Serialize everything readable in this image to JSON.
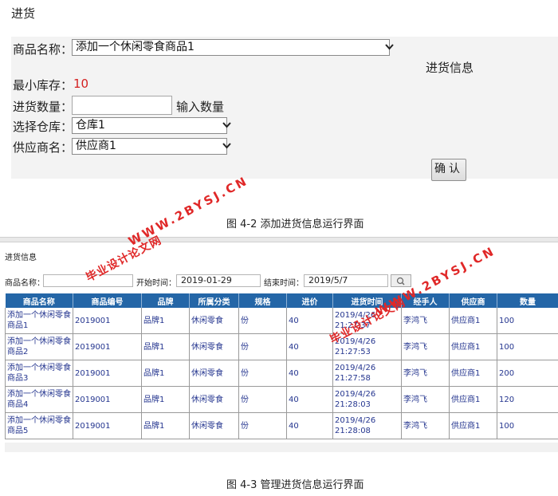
{
  "fig1": {
    "title": "进货",
    "product_label": "商品名称：",
    "product_value": "添加一个休闲零食商品1",
    "section_title": "进货信息",
    "min_stock_label": "最小库存：",
    "min_stock_value": "10",
    "qty_label": "进货数量：",
    "qty_value": "",
    "qty_hint": "输入数量",
    "warehouse_label": "选择仓库：",
    "warehouse_value": "仓库1",
    "supplier_label": "供应商名：",
    "supplier_value": "供应商1",
    "confirm_label": "确认",
    "caption": "图 4-2 添加进货信息运行界面"
  },
  "fig2": {
    "title": "进货信息",
    "search": {
      "product_label": "商品名称：",
      "product_value": "",
      "start_label": "开始时间：",
      "start_value": "2019-01-29",
      "end_label": "结束时间：",
      "end_value": "2019/5/7"
    },
    "columns": [
      "商品名称",
      "商品编号",
      "品牌",
      "所属分类",
      "规格",
      "进价",
      "进货时间",
      "经手人",
      "供应商",
      "数量"
    ],
    "rows": [
      {
        "name": "添加一个休闲零食商品1",
        "code": "2019001",
        "brand": "品牌1",
        "category": "休闲零食",
        "spec": "份",
        "price": "40",
        "time": "2019/4/26 21:27:37",
        "handler": "李鸿飞",
        "supplier": "供应商1",
        "qty": "100"
      },
      {
        "name": "添加一个休闲零食商品2",
        "code": "2019001",
        "brand": "品牌1",
        "category": "休闲零食",
        "spec": "份",
        "price": "40",
        "time": "2019/4/26 21:27:53",
        "handler": "李鸿飞",
        "supplier": "供应商1",
        "qty": "100"
      },
      {
        "name": "添加一个休闲零食商品3",
        "code": "2019001",
        "brand": "品牌1",
        "category": "休闲零食",
        "spec": "份",
        "price": "40",
        "time": "2019/4/26 21:27:58",
        "handler": "李鸿飞",
        "supplier": "供应商1",
        "qty": "200"
      },
      {
        "name": "添加一个休闲零食商品4",
        "code": "2019001",
        "brand": "品牌1",
        "category": "休闲零食",
        "spec": "份",
        "price": "40",
        "time": "2019/4/26 21:28:03",
        "handler": "李鸿飞",
        "supplier": "供应商1",
        "qty": "120"
      },
      {
        "name": "添加一个休闲零食商品5",
        "code": "2019001",
        "brand": "品牌1",
        "category": "休闲零食",
        "spec": "份",
        "price": "40",
        "time": "2019/4/26 21:28:08",
        "handler": "李鸿飞",
        "supplier": "供应商1",
        "qty": "100"
      }
    ],
    "caption": "图 4-3 管理进货信息运行界面"
  },
  "watermarks": {
    "site": "WWW.2BYSJ.CN",
    "label": "毕业设计论文网"
  },
  "colors": {
    "header_bg": "#2466a7",
    "accent_red": "#d42020",
    "watermark_red": "#e02828"
  },
  "icons": {
    "dropdown": "chevron-down-icon",
    "search": "search-icon"
  }
}
